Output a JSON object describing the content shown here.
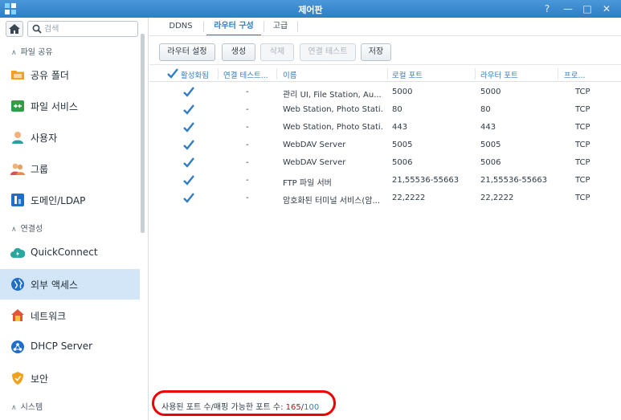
{
  "window": {
    "title": "제어판",
    "help": "?",
    "minimize": "—",
    "maximize": "□",
    "close": "✕"
  },
  "sidebar": {
    "search_placeholder": "검색",
    "sections": [
      {
        "label": "파일 공유"
      },
      {
        "label": "연결성"
      },
      {
        "label": "시스템"
      }
    ],
    "items": [
      {
        "label": "공유 폴더",
        "icon": "shared-folder-icon"
      },
      {
        "label": "파일 서비스",
        "icon": "file-services-icon"
      },
      {
        "label": "사용자",
        "icon": "user-icon"
      },
      {
        "label": "그룹",
        "icon": "group-icon"
      },
      {
        "label": "도메인/LDAP",
        "icon": "domain-ldap-icon"
      },
      {
        "label": "QuickConnect",
        "icon": "quickconnect-icon"
      },
      {
        "label": "외부 액세스",
        "icon": "external-access-icon",
        "active": true
      },
      {
        "label": "네트워크",
        "icon": "network-icon"
      },
      {
        "label": "DHCP Server",
        "icon": "dhcp-server-icon"
      },
      {
        "label": "보안",
        "icon": "security-icon"
      }
    ]
  },
  "tabs": [
    {
      "label": "DDNS"
    },
    {
      "label": "라우터 구성",
      "active": true
    },
    {
      "label": "고급"
    }
  ],
  "toolbar": {
    "router_settings": "라우터 설정",
    "create": "생성",
    "delete": "삭제",
    "connection_test": "연결 테스트",
    "save": "저장"
  },
  "table": {
    "headers": [
      "활성화됨",
      "연결 테스트...",
      "이름",
      "로컬 포트",
      "라우터 포트",
      "프로..."
    ],
    "rows": [
      {
        "enabled": true,
        "test": "-",
        "name": "관리 UI, File Station, Au...",
        "local": "5000",
        "router": "5000",
        "protocol": "TCP"
      },
      {
        "enabled": true,
        "test": "-",
        "name": "Web Station, Photo Stati...",
        "local": "80",
        "router": "80",
        "protocol": "TCP"
      },
      {
        "enabled": true,
        "test": "-",
        "name": "Web Station, Photo Stati...",
        "local": "443",
        "router": "443",
        "protocol": "TCP"
      },
      {
        "enabled": true,
        "test": "-",
        "name": "WebDAV Server",
        "local": "5005",
        "router": "5005",
        "protocol": "TCP"
      },
      {
        "enabled": true,
        "test": "-",
        "name": "WebDAV Server",
        "local": "5006",
        "router": "5006",
        "protocol": "TCP"
      },
      {
        "enabled": true,
        "test": "-",
        "name": "FTP 파일 서버",
        "local": "21,55536-55663",
        "router": "21,55536-55663",
        "protocol": "TCP"
      },
      {
        "enabled": true,
        "test": "-",
        "name": "암호화된 터미널 서비스(암...",
        "local": "22,2222",
        "router": "22,2222",
        "protocol": "TCP"
      }
    ]
  },
  "footer": {
    "label": "사용된 포트 수/매핑 가능한 포트 수: ",
    "used": "165",
    "separator": "/",
    "max": "100"
  },
  "colors": {
    "accent": "#2f7dc6",
    "active_bg": "#d2e6f8",
    "highlight": "#ee0000",
    "used_count": "#d0021b"
  }
}
